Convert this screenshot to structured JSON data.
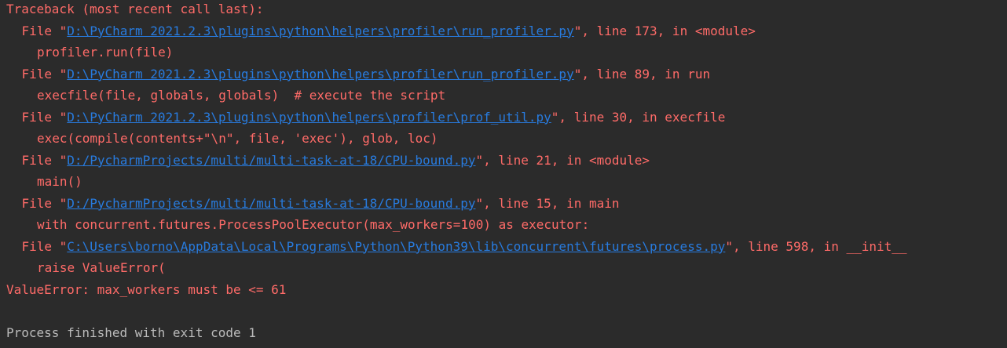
{
  "colors": {
    "background": "#2b2b2b",
    "error_text": "#ff6b68",
    "link": "#287bde",
    "normal_text": "#bbbbbb"
  },
  "console": {
    "traceback_header": "Traceback (most recent call last):",
    "frames": [
      {
        "prefix": "File \"",
        "path": "D:\\PyCharm 2021.2.3\\plugins\\python\\helpers\\profiler\\run_profiler.py",
        "suffix": "\", line 173, in <module>",
        "code": "profiler.run(file)"
      },
      {
        "prefix": "File \"",
        "path": "D:\\PyCharm 2021.2.3\\plugins\\python\\helpers\\profiler\\run_profiler.py",
        "suffix": "\", line 89, in run",
        "code": "execfile(file, globals, globals)  # execute the script"
      },
      {
        "prefix": "File \"",
        "path": "D:\\PyCharm 2021.2.3\\plugins\\python\\helpers\\profiler\\prof_util.py",
        "suffix": "\", line 30, in execfile",
        "code": "exec(compile(contents+\"\\n\", file, 'exec'), glob, loc)"
      },
      {
        "prefix": "File \"",
        "path": "D:/PycharmProjects/multi/multi-task-at-18/CPU-bound.py",
        "suffix": "\", line 21, in <module>",
        "code": "main()"
      },
      {
        "prefix": "File \"",
        "path": "D:/PycharmProjects/multi/multi-task-at-18/CPU-bound.py",
        "suffix": "\", line 15, in main",
        "code": "with concurrent.futures.ProcessPoolExecutor(max_workers=100) as executor:"
      },
      {
        "prefix": "File \"",
        "path": "C:\\Users\\borno\\AppData\\Local\\Programs\\Python\\Python39\\lib\\concurrent\\futures\\process.py",
        "suffix": "\", line 598, in __init__",
        "code": "raise ValueError("
      }
    ],
    "error_message": "ValueError: max_workers must be <= 61",
    "exit_message": "Process finished with exit code 1"
  }
}
